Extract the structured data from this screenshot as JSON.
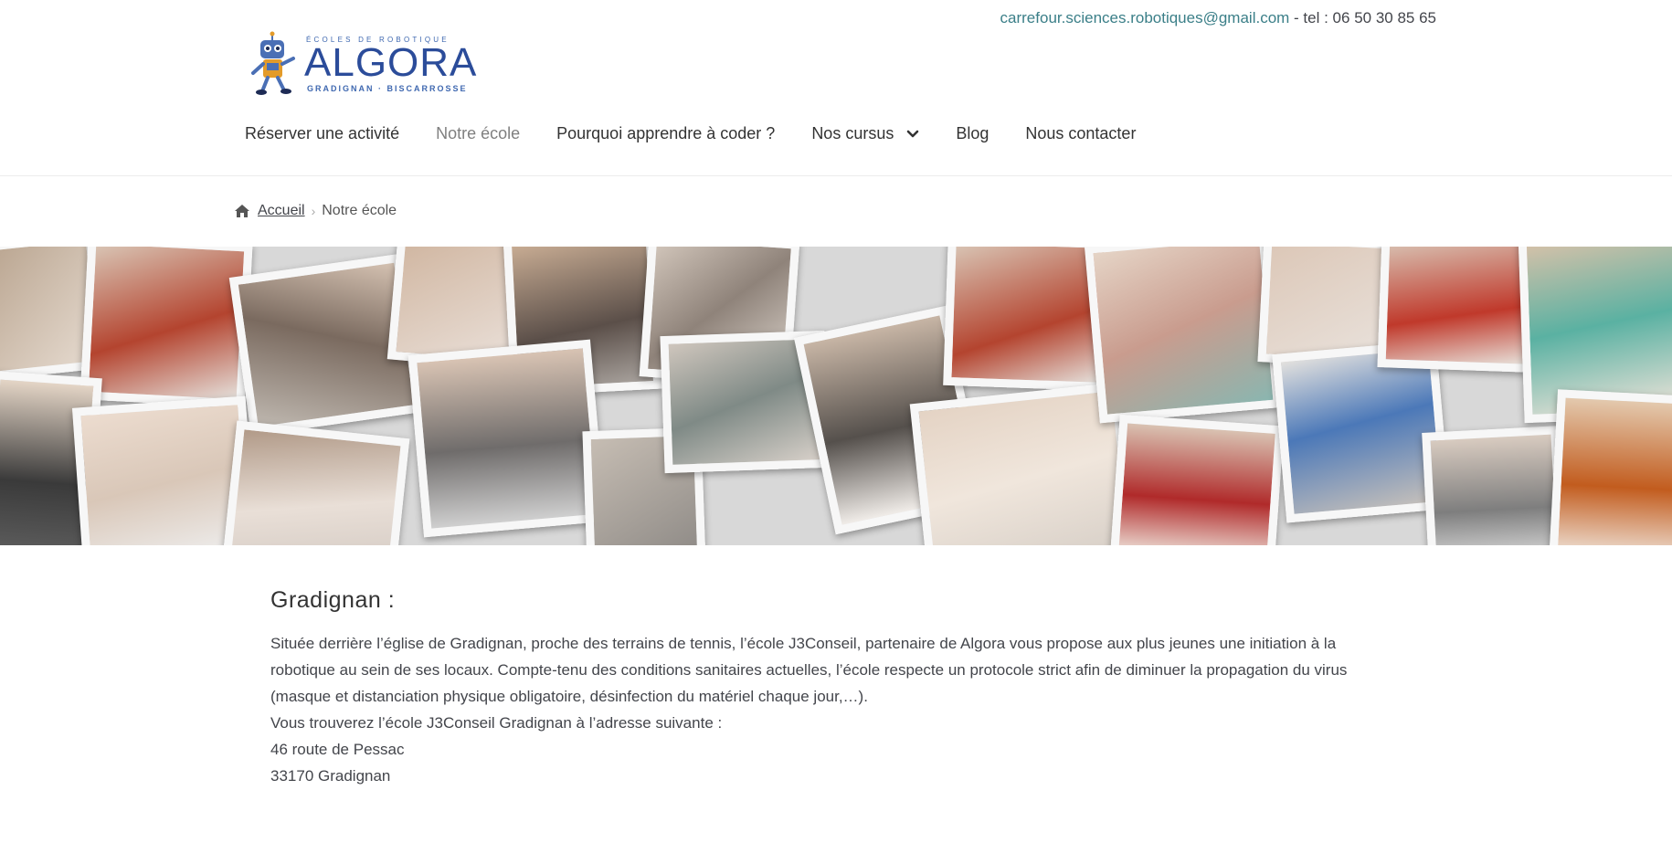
{
  "header": {
    "email": "carrefour.sciences.robotiques@gmail.com",
    "phone_text": " - tel : 06 50 30 85 65"
  },
  "logo": {
    "tagline": "ÉCOLES DE ROBOTIQUE",
    "name": "ALGORA",
    "subline": "GRADIGNAN · BISCARROSSE"
  },
  "nav": {
    "items": [
      {
        "label": "Réserver une activité"
      },
      {
        "label": "Notre école"
      },
      {
        "label": "Pourquoi apprendre à coder ?"
      },
      {
        "label": "Nos cursus"
      },
      {
        "label": "Blog"
      },
      {
        "label": "Nous contacter"
      }
    ]
  },
  "breadcrumb": {
    "home": "Accueil",
    "current": "Notre école"
  },
  "content": {
    "heading": "Gradignan :",
    "paragraph1": "Située derrière l’église de Gradignan, proche des terrains de tennis, l’école J3Conseil, partenaire de Algora vous propose aux plus jeunes une initiation à la robotique au sein de ses locaux. Compte-tenu des conditions sanitaires actuelles, l’école respecte un protocole strict afin de diminuer la propagation du virus (masque et distanciation physique obligatoire, désinfection du matériel chaque jour,…).",
    "line2": "Vous trouverez l’école J3Conseil Gradignan à l’adresse suivante :",
    "address1": "46 route de Pessac",
    "address2": "33170 Gradignan"
  },
  "colors": {
    "link": "#3b7f88",
    "text": "#43454b",
    "logo_blue": "#2b4c9a"
  }
}
